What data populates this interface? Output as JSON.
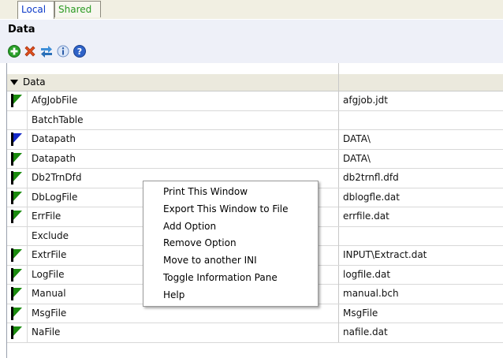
{
  "tabs": [
    {
      "label": "Local",
      "color": "#0a38c8"
    },
    {
      "label": "Shared",
      "color": "#2a9a22"
    }
  ],
  "panel": {
    "title": "Data"
  },
  "toolbar": {
    "icons": [
      "add-icon",
      "delete-icon",
      "move-icon",
      "info-icon",
      "help-icon"
    ]
  },
  "grid": {
    "group_label": "Data",
    "rows": [
      {
        "name": "AfgJobFile",
        "value": "afgjob.jdt",
        "marker": "green"
      },
      {
        "name": "BatchTable",
        "value": "",
        "marker": "none"
      },
      {
        "name": "Datapath",
        "value": "DATA\\",
        "marker": "blue"
      },
      {
        "name": "Datapath",
        "value": "DATA\\",
        "marker": "green"
      },
      {
        "name": "Db2TrnDfd",
        "value": "db2trnfl.dfd",
        "marker": "green"
      },
      {
        "name": "DbLogFile",
        "value": "dblogfle.dat",
        "marker": "green"
      },
      {
        "name": "ErrFile",
        "value": "errfile.dat",
        "marker": "green"
      },
      {
        "name": "Exclude",
        "value": "",
        "marker": "none"
      },
      {
        "name": "ExtrFile",
        "value": "INPUT\\Extract.dat",
        "marker": "green"
      },
      {
        "name": "LogFile",
        "value": "logfile.dat",
        "marker": "green"
      },
      {
        "name": "Manual",
        "value": "manual.bch",
        "marker": "green"
      },
      {
        "name": "MsgFile",
        "value": "MsgFile",
        "marker": "green"
      },
      {
        "name": "NaFile",
        "value": "nafile.dat",
        "marker": "green"
      }
    ]
  },
  "context_menu": {
    "items": [
      "Print This Window",
      "Export This Window to File",
      "Add Option",
      "Remove Option",
      "Move to another INI",
      "Toggle Information Pane",
      "Help"
    ]
  }
}
